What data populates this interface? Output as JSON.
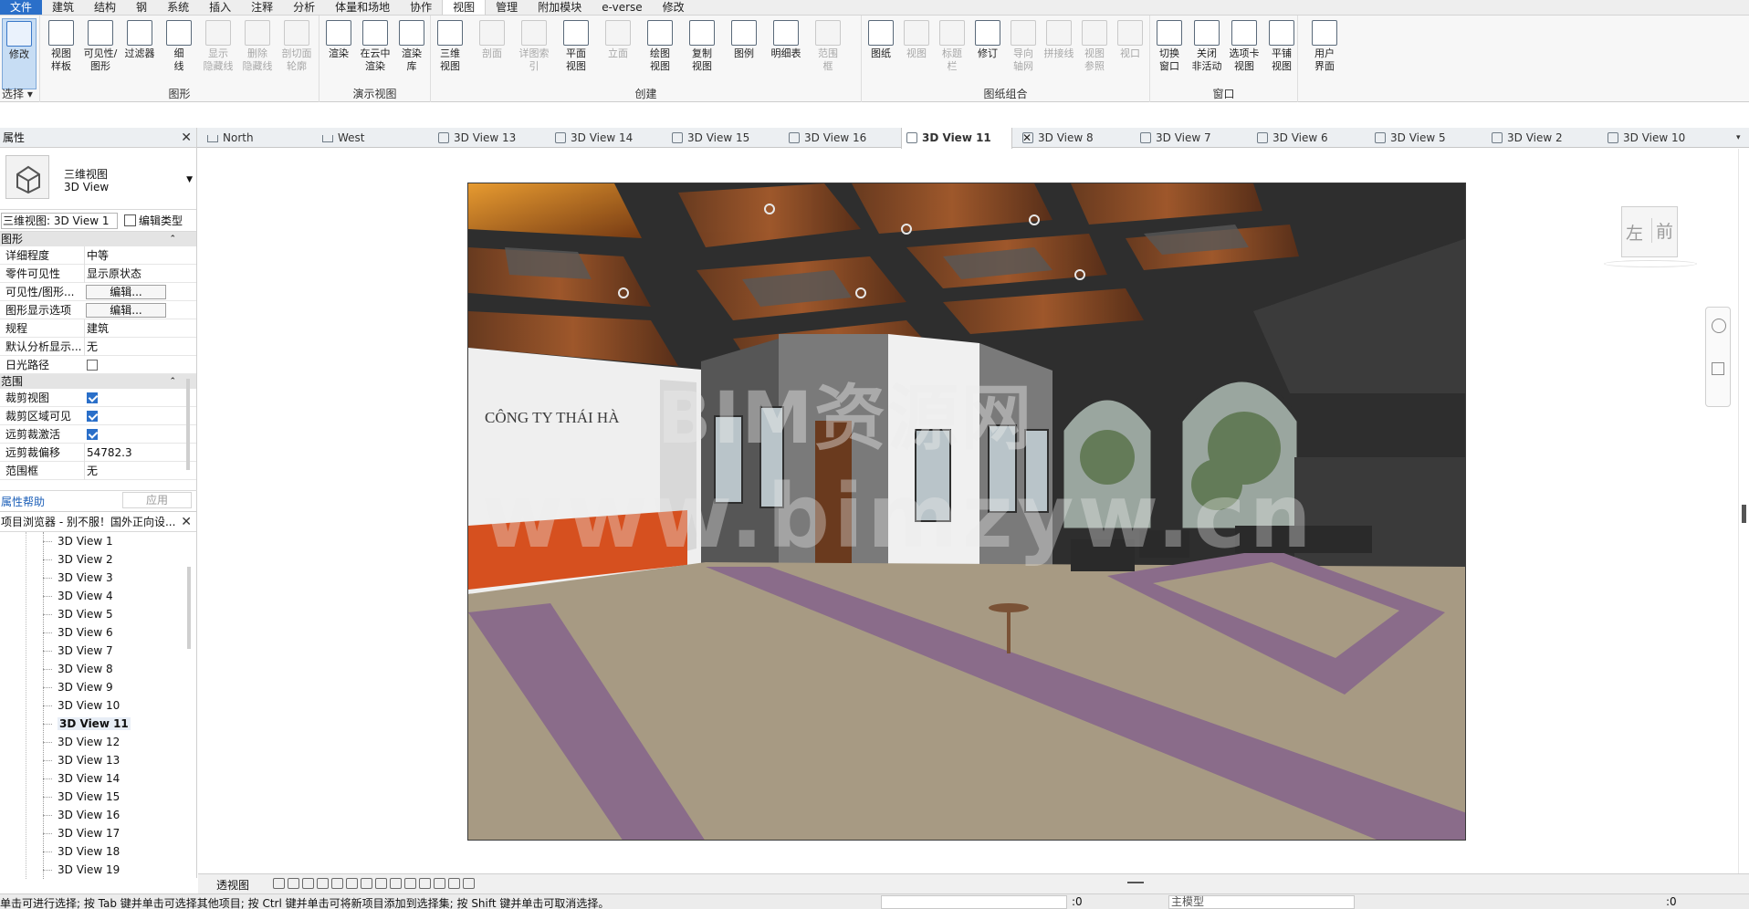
{
  "menu": {
    "items": [
      "文件",
      "建筑",
      "结构",
      "钢",
      "系统",
      "插入",
      "注释",
      "分析",
      "体量和场地",
      "协作",
      "视图",
      "管理",
      "附加模块",
      "e-verse",
      "修改"
    ],
    "active": "视图"
  },
  "ribbon": {
    "select_btn": "修改",
    "select_label": "选择",
    "graphics": {
      "label": "图形",
      "buttons": [
        "视图\n样板",
        "可见性/\n图形",
        "过滤器",
        "细\n线",
        "显示\n隐藏线",
        "删除\n隐藏线",
        "剖切面\n轮廓"
      ]
    },
    "presentation": {
      "label": "演示视图",
      "buttons": [
        "渲染",
        "在云中\n渲染",
        "渲染\n库"
      ]
    },
    "create": {
      "label": "创建",
      "buttons": [
        "三维\n视图",
        "剖面",
        "详图索引",
        "平面\n视图",
        "立面",
        "绘图\n视图",
        "复制\n视图",
        "图例",
        "明细表",
        "范围\n框"
      ]
    },
    "sheet": {
      "label": "图纸组合",
      "buttons": [
        "图纸",
        "视图",
        "标题\n栏",
        "修订",
        "导向\n轴网",
        "拼接线",
        "视图\n参照",
        "视口"
      ]
    },
    "windows": {
      "label": "窗口",
      "buttons": [
        "切换\n窗口",
        "关闭\n非活动",
        "选项卡\n视图",
        "平铺\n视图"
      ]
    },
    "ui": {
      "buttons": [
        "用户\n界面"
      ]
    }
  },
  "tabs": [
    "North",
    "West",
    "3D View 13",
    "3D View 14",
    "3D View 15",
    "3D View 16",
    "3D View 11",
    "3D View 8",
    "3D View 7",
    "3D View 6",
    "3D View 5",
    "3D View 2",
    "3D View 10"
  ],
  "properties": {
    "title": "属性",
    "type_line1": "三维视图",
    "type_line2": "3D View",
    "filter": "三维视图: 3D View 1",
    "edit_type": "编辑类型",
    "sections": [
      {
        "name": "图形",
        "rows": [
          {
            "k": "详细程度",
            "v": "中等"
          },
          {
            "k": "零件可见性",
            "v": "显示原状态"
          },
          {
            "k": "可见性/图形...",
            "btn": "编辑..."
          },
          {
            "k": "图形显示选项",
            "btn": "编辑..."
          },
          {
            "k": "规程",
            "v": "建筑"
          },
          {
            "k": "默认分析显示...",
            "v": "无"
          },
          {
            "k": "日光路径",
            "chk": false
          }
        ]
      },
      {
        "name": "范围",
        "rows": [
          {
            "k": "裁剪视图",
            "chk": true
          },
          {
            "k": "裁剪区域可见",
            "chk": true
          },
          {
            "k": "远剪裁激活",
            "chk": true
          },
          {
            "k": "远剪裁偏移",
            "v": "54782.3"
          },
          {
            "k": "范围框",
            "v": "无"
          }
        ]
      }
    ],
    "help": "属性帮助",
    "apply": "应用"
  },
  "browser": {
    "title": "项目浏览器 - 别不服！国外正向设...",
    "items": [
      "3D View 1",
      "3D View 2",
      "3D View 3",
      "3D View 4",
      "3D View 5",
      "3D View 6",
      "3D View 7",
      "3D View 8",
      "3D View 9",
      "3D View 10",
      "3D View 11",
      "3D View 12",
      "3D View 13",
      "3D View 14",
      "3D View 15",
      "3D View 16",
      "3D View 17",
      "3D View 18",
      "3D View 19"
    ],
    "selected": "3D View 11"
  },
  "render": {
    "sign": "CÔNG TY THÁI HÀ"
  },
  "watermark": {
    "line1": "BIM资源网",
    "line2": "www.bimzyw.cn"
  },
  "viewcube": {
    "left": "左",
    "front": "前"
  },
  "view_control": {
    "scale": "透视图"
  },
  "status": {
    "message": "单击可进行选择; 按 Tab 键并单击可选择其他项目; 按 Ctrl 键并单击可将新项目添加到选择集; 按 Shift 键并单击可取消选择。",
    "zero": ":0",
    "model": "主模型",
    "zero2": ":0"
  },
  "colors": {
    "file_tab": "#2a6fc9",
    "accent": "#2a6fc9",
    "counter": "#d6501f"
  }
}
